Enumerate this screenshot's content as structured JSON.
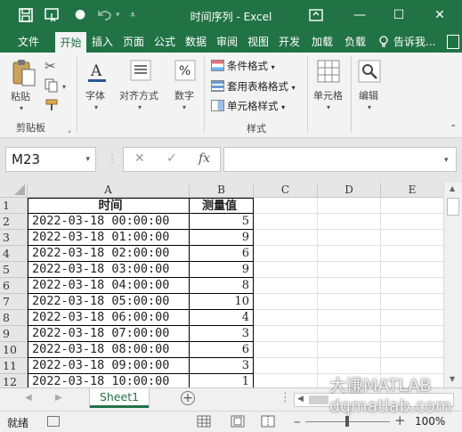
{
  "window": {
    "title": "时间序列 - Excel",
    "accent": "#217346"
  },
  "ribbon_tabs": [
    "文件",
    "开始",
    "插入",
    "页面",
    "公式",
    "数据",
    "审阅",
    "视图",
    "开发",
    "加载",
    "负载",
    "告诉我..."
  ],
  "ribbon": {
    "clipboard": {
      "paste_label": "粘贴",
      "group_label": "剪贴板"
    },
    "font_label": "字体",
    "align_label": "对齐方式",
    "number_label": "数字",
    "styles": {
      "conditional": "条件格式",
      "table": "套用表格格式",
      "cell_style": "单元格样式",
      "group_label": "样式"
    },
    "cells_label": "单元格",
    "edit_label": "编辑"
  },
  "formula_bar": {
    "name_box": "M23",
    "fx": "fx",
    "formula": ""
  },
  "columns": [
    "A",
    "B",
    "C",
    "D",
    "E"
  ],
  "rows": [
    {
      "num": "1",
      "a": "时间",
      "b": "测量值",
      "header": true
    },
    {
      "num": "2",
      "a": "2022-03-18 00:00:00",
      "b": "5"
    },
    {
      "num": "3",
      "a": "2022-03-18 01:00:00",
      "b": "9"
    },
    {
      "num": "4",
      "a": "2022-03-18 02:00:00",
      "b": "6"
    },
    {
      "num": "5",
      "a": "2022-03-18 03:00:00",
      "b": "9"
    },
    {
      "num": "6",
      "a": "2022-03-18 04:00:00",
      "b": "8"
    },
    {
      "num": "7",
      "a": "2022-03-18 05:00:00",
      "b": "10"
    },
    {
      "num": "8",
      "a": "2022-03-18 06:00:00",
      "b": "4"
    },
    {
      "num": "9",
      "a": "2022-03-18 07:00:00",
      "b": "3"
    },
    {
      "num": "10",
      "a": "2022-03-18 08:00:00",
      "b": "6"
    },
    {
      "num": "11",
      "a": "2022-03-18 09:00:00",
      "b": "3"
    },
    {
      "num": "12",
      "a": "2022-03-18 10:00:00",
      "b": "1"
    }
  ],
  "sheets": [
    "Sheet1"
  ],
  "status": {
    "ready": "就绪",
    "zoom": "100%"
  },
  "watermark": [
    "大谦MATLAB",
    "dqmatlab.com"
  ]
}
